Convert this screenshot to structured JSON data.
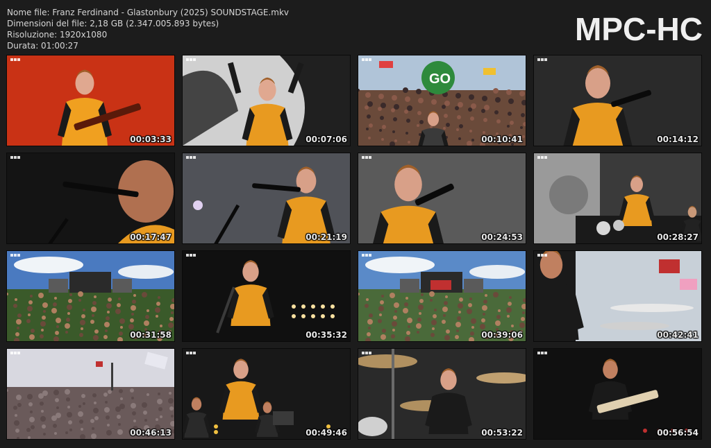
{
  "info": {
    "file_name": "Nome file: Franz Ferdinand - Glastonbury (2025) SOUNDSTAGE.mkv",
    "file_size": "Dimensioni del file: 2,18 GB (2.347.005.893 bytes)",
    "resolution": "Risoluzione: 1920x1080",
    "duration": "Durata: 01:00:27"
  },
  "brand": "MPC-HC",
  "thumbnails": [
    {
      "time": "00:03:33",
      "scene": "singer-red-background",
      "colors": [
        "#d93a1a",
        "#b92a10",
        "#f0a020"
      ]
    },
    {
      "time": "00:07:06",
      "scene": "singer-arms-raised",
      "colors": [
        "#d0d0d0",
        "#202020",
        "#e89a20"
      ]
    },
    {
      "time": "00:10:41",
      "scene": "crowd-go-sign",
      "colors": [
        "#b0c4d8",
        "#6a4a3a",
        "#2e8a3c"
      ]
    },
    {
      "time": "00:14:12",
      "scene": "singer-closeup-microphone",
      "colors": [
        "#2a2a2a",
        "#c08060",
        "#e89a20"
      ]
    },
    {
      "time": "00:17:47",
      "scene": "singer-side-profile",
      "colors": [
        "#141414",
        "#b07050",
        "#e89a20"
      ]
    },
    {
      "time": "00:21:19",
      "scene": "singer-grey-background",
      "colors": [
        "#505258",
        "#b07050",
        "#e89a20"
      ]
    },
    {
      "time": "00:24:53",
      "scene": "singer-closeup-grey",
      "colors": [
        "#5a5a5a",
        "#c08060",
        "#e89a20"
      ]
    },
    {
      "time": "00:28:27",
      "scene": "stage-wide-drums",
      "colors": [
        "#3a3a3a",
        "#9a9a9a",
        "#e89a20"
      ]
    },
    {
      "time": "00:31:58",
      "scene": "festival-wide-blue-sky",
      "colors": [
        "#4a7ac0",
        "#3a5a2a",
        "#8a4a3a"
      ]
    },
    {
      "time": "00:35:32",
      "scene": "singer-dark-stage-lights",
      "colors": [
        "#101010",
        "#e89a20",
        "#f8e0a0"
      ]
    },
    {
      "time": "00:39:06",
      "scene": "festival-wide-stage",
      "colors": [
        "#5a8ac8",
        "#4a6a3a",
        "#c03030"
      ]
    },
    {
      "time": "00:42:41",
      "scene": "drummer-flags",
      "colors": [
        "#c8d0d8",
        "#1a1a1a",
        "#c03030"
      ]
    },
    {
      "time": "00:46:13",
      "scene": "crowd-flags-haze",
      "colors": [
        "#d8d8e0",
        "#6a5a5a",
        "#2a3a8a"
      ]
    },
    {
      "time": "00:49:46",
      "scene": "band-dark-stage",
      "colors": [
        "#181818",
        "#e89a20",
        "#3a3a3a"
      ]
    },
    {
      "time": "00:53:22",
      "scene": "drummer-cymbals",
      "colors": [
        "#2a2a2a",
        "#b09060",
        "#d0d0d0"
      ]
    },
    {
      "time": "00:56:54",
      "scene": "guitarist-dark-stage",
      "colors": [
        "#101010",
        "#e0d0b0",
        "#c03030"
      ]
    }
  ]
}
